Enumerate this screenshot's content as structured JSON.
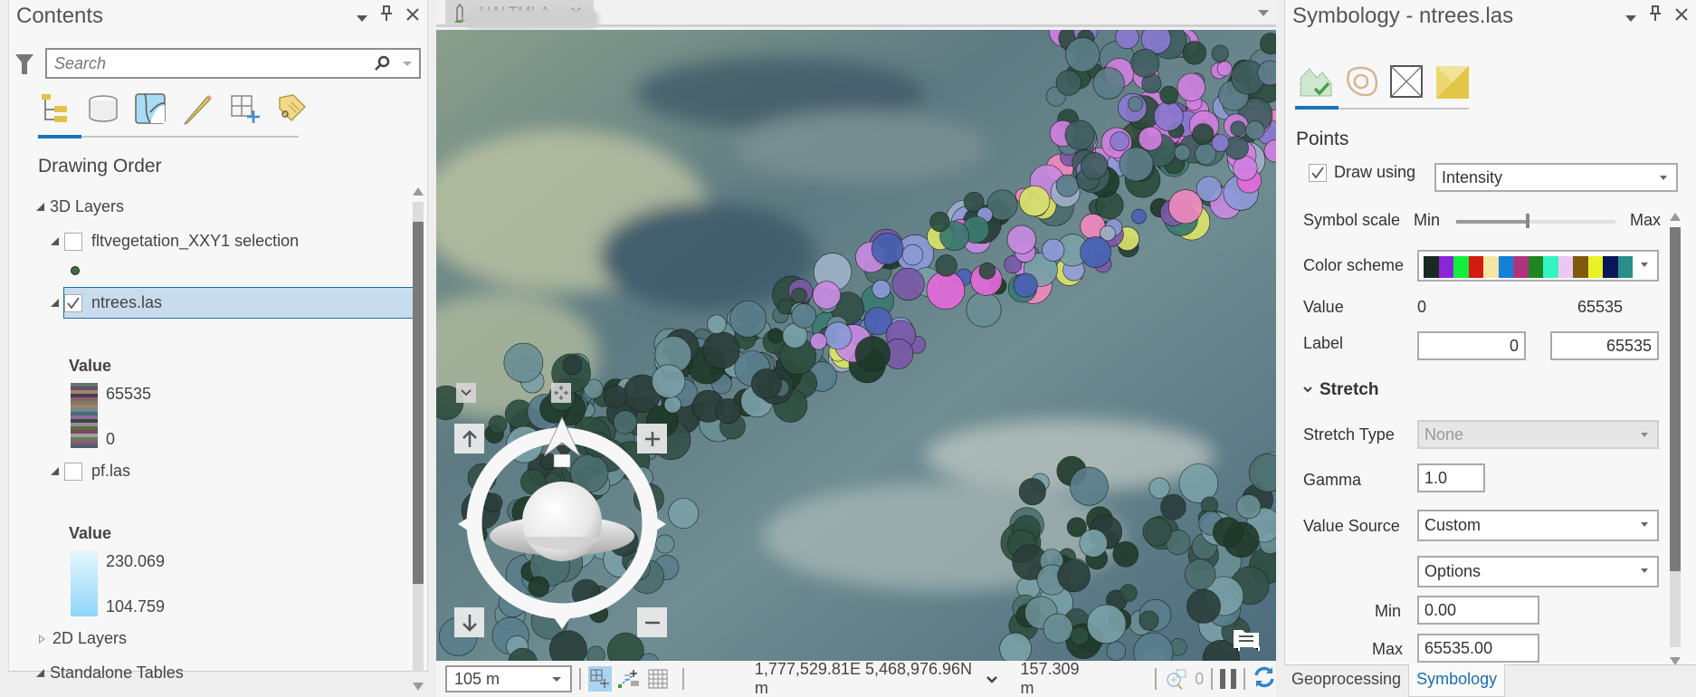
{
  "contents": {
    "title": "Contents",
    "search_placeholder": "Search",
    "section_title": "Drawing Order",
    "groups": {
      "layers_3d": "3D Layers",
      "layers_2d": "2D Layers",
      "standalone_tables": "Standalone Tables"
    },
    "layers": [
      {
        "name": "fltvegetation_XXY1 selection",
        "checked": false
      },
      {
        "name": "ntrees.las",
        "checked": true,
        "selected": true,
        "legend_title": "Value",
        "legend_high": "65535",
        "legend_low": "0"
      },
      {
        "name": "pf.las",
        "checked": false,
        "legend_title": "Value",
        "legend_high": "230.069",
        "legend_low": "104.759"
      }
    ]
  },
  "map": {
    "tab_label": "HALTMI-A",
    "scale": "105 m",
    "coordinates": "1,777,529.81E 5,468,976.96N m",
    "elevation": "157.309 m",
    "selected_count": "0"
  },
  "symbology": {
    "title": "Symbology - ntrees.las",
    "section_points": "Points",
    "draw_using_label": "Draw using",
    "draw_using_checked": true,
    "draw_using_value": "Intensity",
    "symbol_scale_label": "Symbol scale",
    "symbol_scale_min": "Min",
    "symbol_scale_max": "Max",
    "symbol_scale_position": 0.45,
    "color_scheme_label": "Color scheme",
    "color_scheme": [
      "#1a2a22",
      "#8a25d8",
      "#12ee3c",
      "#d41b12",
      "#f5e6a6",
      "#1381da",
      "#b0347c",
      "#208423",
      "#33f5c2",
      "#ecc7f4",
      "#805a0a",
      "#e8f227",
      "#08175a",
      "#2a8e8b"
    ],
    "value_label": "Value",
    "value_min": "0",
    "value_max": "65535",
    "label_label": "Label",
    "label_min": "0",
    "label_max": "65535",
    "stretch_title": "Stretch",
    "stretch_type_label": "Stretch Type",
    "stretch_type_value": "None",
    "gamma_label": "Gamma",
    "gamma_value": "1.0",
    "value_source_label": "Value Source",
    "value_source_value": "Custom",
    "options_value": "Options",
    "min_label": "Min",
    "min_value": "0.00",
    "max_label": "Max",
    "max_value": "65535.00"
  },
  "bottom_tabs": {
    "geoprocessing": "Geoprocessing",
    "symbology": "Symbology"
  },
  "colors": {
    "accent": "#1a73b9",
    "selection_bg": "#c9dcee",
    "selection_border": "#1d6fa5"
  }
}
